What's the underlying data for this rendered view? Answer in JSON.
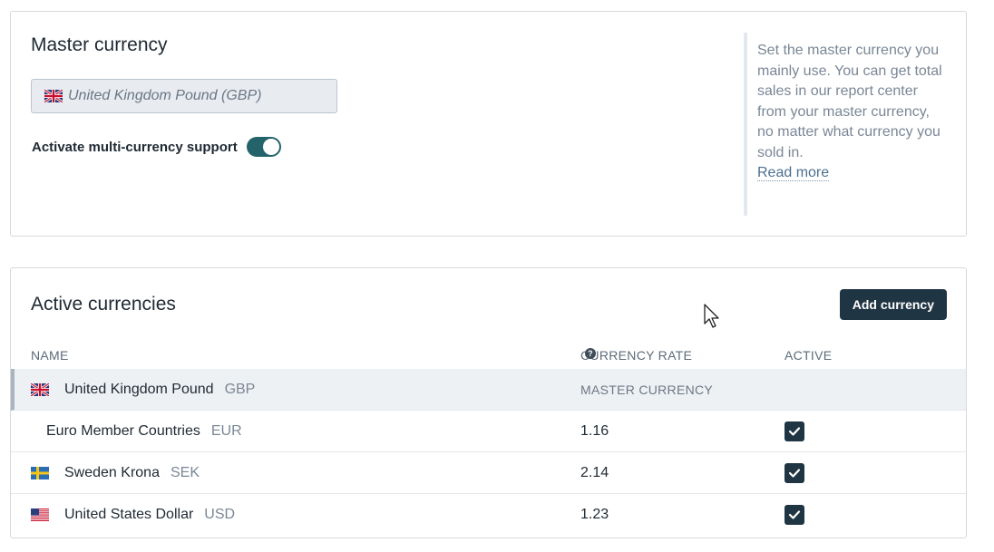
{
  "master_section": {
    "title": "Master currency",
    "selected_currency": "United Kingdom Pound (GBP)",
    "selected_flag_icon": "uk-flag-icon",
    "toggle_label": "Activate multi-currency support",
    "toggle_on": true,
    "help_text": "Set the master currency you mainly use. You can get total sales in our report center from your master currency, no matter what currency you sold in.",
    "help_link": "Read more"
  },
  "active_section": {
    "title": "Active currencies",
    "add_button": "Add currency",
    "columns": {
      "name": "NAME",
      "rate": "CURRENCY RATE",
      "active": "ACTIVE"
    },
    "rows": [
      {
        "name": "United Kingdom Pound",
        "code": "GBP",
        "rate": "MASTER CURRENCY",
        "flag_icon": "uk-flag-icon",
        "active": null
      },
      {
        "name": "Euro Member Countries",
        "code": "EUR",
        "rate": "1.16",
        "flag_icon": null,
        "active": true
      },
      {
        "name": "Sweden Krona",
        "code": "SEK",
        "rate": "2.14",
        "flag_icon": "sweden-flag-icon",
        "active": true
      },
      {
        "name": "United States Dollar",
        "code": "USD",
        "rate": "1.23",
        "flag_icon": "usa-flag-icon",
        "active": true
      }
    ]
  },
  "colors": {
    "toggle_on": "#25636b",
    "button_dark": "#203543",
    "link": "#4d6f8f"
  }
}
